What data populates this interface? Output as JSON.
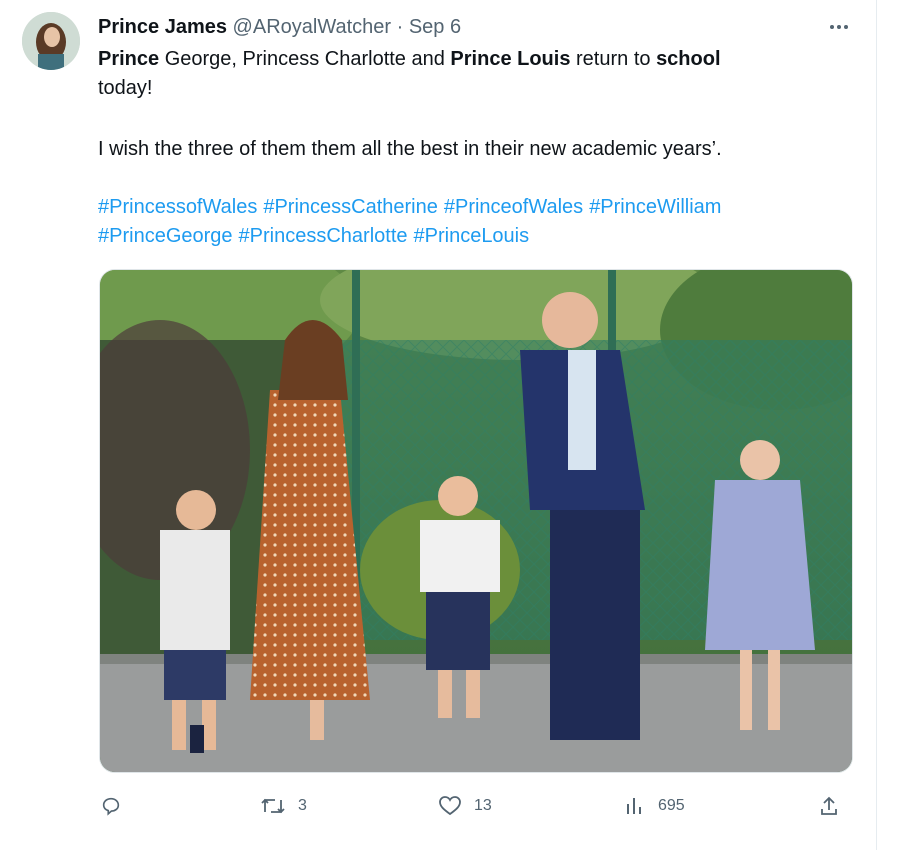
{
  "tweet": {
    "author_name": "Prince James",
    "handle": "@ARoyalWatcher",
    "separator": "·",
    "date": "Sep 6",
    "line1": {
      "w1": "Prince",
      "w2": " George, Princess Charlotte and ",
      "w3": "Prince Louis",
      "w4": " return to ",
      "w5": "school"
    },
    "line2": "today!",
    "line3": "I wish the three of them them all the best in their new academic years’.",
    "hashtags": [
      "#PrincessofWales",
      "#PrincessCatherine",
      "#PrinceofWales",
      "#PrinceWilliam",
      "#PrinceGeorge",
      "#PrincessCharlotte",
      "#PrinceLouis"
    ],
    "stats": {
      "replies": "",
      "retweets": "3",
      "likes": "13",
      "views": "695"
    }
  },
  "icons": {
    "more": "more-icon",
    "reply": "reply-icon",
    "retweet": "retweet-icon",
    "like": "heart-icon",
    "views": "views-icon",
    "share": "share-icon"
  },
  "colors": {
    "hashtag": "#1d9bf0",
    "muted": "#536471",
    "text": "#0f1419"
  }
}
